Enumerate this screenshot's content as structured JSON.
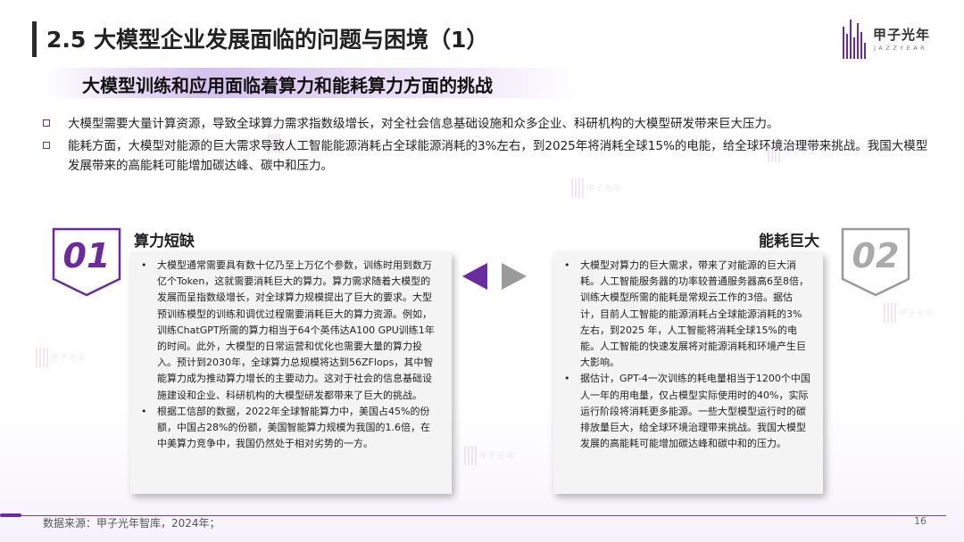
{
  "header": {
    "title": "2.5 大模型企业发展面临的问题与困境（1）",
    "subtitle": "大模型训练和应用面临着算力和能耗算力方面的挑战"
  },
  "logo": {
    "name": "甲子光年",
    "sub": "JAZZYEAR"
  },
  "watermark": {
    "text": "甲子光年"
  },
  "bullets": [
    "大模型需要大量计算资源，导致全球算力需求指数级增长，对全社会信息基础设施和众多企业、科研机构的大模型研发带来巨大压力。",
    "能耗方面，大模型对能源的巨大需求导致人工智能能源消耗占全球能源消耗的3%左右，到2025年将消耗全球15%的电能，给全球环境治理带来挑战。我国大模型发展带来的高能耗可能增加碳达峰、碳中和压力。"
  ],
  "left_section": {
    "number": "01",
    "heading": "算力短缺",
    "items": [
      "大模型通常需要具有数十亿乃至上万亿个参数，训练时用到数万亿个Token，这就需要消耗巨大的算力。算力需求随着大模型的发展而呈指数级增长，对全球算力规模提出了巨大的要求。大型预训练模型的训练和调优过程需要消耗巨大的算力资源。例如，训练ChatGPT所需的算力相当于64个英伟达A100 GPU训练1年的时间。此外，大模型的日常运营和优化也需要大量的算力投入。预计到2030年，全球算力总规模将达到56ZFlops，其中智能算力成为推动算力增长的主要动力。这对于社会的信息基础设施建设和企业、科研机构的大模型研发都带来了巨大的挑战。",
      "根据工信部的数据，2022年全球智能算力中，美国占45%的份额，中国占28%的份额，美国智能算力规模为我国的1.6倍，在中美算力竞争中，我国仍然处于相对劣势的一方。"
    ]
  },
  "right_section": {
    "number": "02",
    "heading": "能耗巨大",
    "items": [
      "大模型对算力的巨大需求，带来了对能源的巨大消耗。人工智能服务器的功率较普通服务器高6至8倍，训练大模型所需的能耗是常规云工作的3倍。据估计，目前人工智能的能源消耗占全球能源消耗的3%左右，到2025 年，人工智能将消耗全球15%的电能。人工智能的快速发展将对能源消耗和环境产生巨大影响。",
      "据估计，GPT-4一次训练的耗电量相当于1200个中国人一年的用电量，仅占模型实际使用时的40%，实际运行阶段将消耗更多能源。一些大型模型运行时的碳排放量巨大，给全球环境治理带来挑战。我国大模型发展的高能耗可能增加碳达峰和碳中和的压力。"
    ]
  },
  "footer": {
    "source": "数据来源：甲子光年智库，2024年；",
    "page": "16"
  },
  "colors": {
    "accent": "#6a2aa0",
    "secondary": "#9a9a9a"
  }
}
